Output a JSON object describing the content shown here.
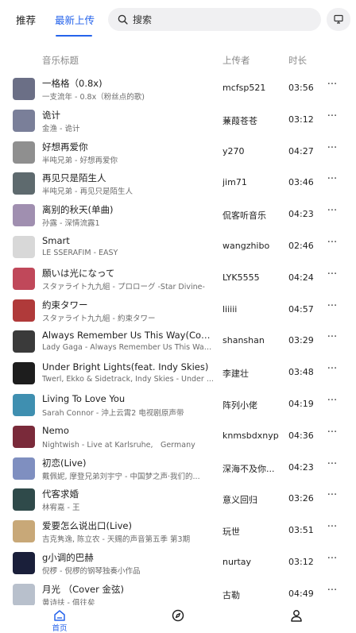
{
  "header": {
    "tabs": [
      {
        "label": "推荐",
        "active": false
      },
      {
        "label": "最新上传",
        "active": true
      }
    ],
    "search": {
      "placeholder": "搜索",
      "icon": "search-icon"
    },
    "monitor_icon": "monitor-icon",
    "accent_color": "#2563eb"
  },
  "columns": {
    "title": "音乐标题",
    "uploader": "上传者",
    "duration": "时长"
  },
  "songs": [
    {
      "title": "一格格（0.8x)",
      "sub": "一支流年 - 0.8x（粉丝点的歌)",
      "uploader": "mcfsp521",
      "duration": "03:56",
      "cover": "#6b6f86"
    },
    {
      "title": "诡计",
      "sub": "金渔 - 诡计",
      "uploader": "蒹葭苍苍",
      "duration": "03:12",
      "cover": "#7a7f99"
    },
    {
      "title": "好想再爱你",
      "sub": "半吨兄弟 - 好想再爱你",
      "uploader": "y270",
      "duration": "04:27",
      "cover": "#8f8f8f"
    },
    {
      "title": "再见只是陌生人",
      "sub": "半吨兄弟 - 再见只是陌生人",
      "uploader": "jim71",
      "duration": "03:46",
      "cover": "#5e6a6e"
    },
    {
      "title": "离别的秋天(单曲)",
      "sub": "孙露 - 深情流露1",
      "uploader": "侃客听音乐",
      "duration": "04:23",
      "cover": "#a08fb0"
    },
    {
      "title": "Smart",
      "sub": "LE SSERAFIM - EASY",
      "uploader": "wangzhibo",
      "duration": "02:46",
      "cover": "#d8d8d8"
    },
    {
      "title": "願いは光になって",
      "sub": "スタァライト九九組 - プロローグ -Star Divine-",
      "uploader": "LYK5555",
      "duration": "04:24",
      "cover": "#c0485a"
    },
    {
      "title": "約束タワー",
      "sub": "スタァライト九九組 - 約束タワー",
      "uploader": "liiiii",
      "duration": "04:57",
      "cover": "#b03a3a"
    },
    {
      "title": "Always Remember Us This Way(Compl...",
      "sub": "Lady Gaga - Always Remember Us This Way (...",
      "uploader": "shanshan",
      "duration": "03:29",
      "cover": "#3a3a3a"
    },
    {
      "title": "Under Bright Lights(feat. Indy Skies)",
      "sub": "Twerl, Ekko & Sidetrack, Indy Skies - Under ...",
      "uploader": "李建壮",
      "duration": "03:48",
      "cover": "#1d1d1d"
    },
    {
      "title": "Living To Love You",
      "sub": "Sarah Connor - 沖上云霄2 电视剧原声带",
      "uploader": "阵列小佬",
      "duration": "04:19",
      "cover": "#3f8fb0"
    },
    {
      "title": "Nemo",
      "sub": "Nightwish - Live at Karlsruhe,　Germany",
      "uploader": "knmsbdxnyp",
      "duration": "04:36",
      "cover": "#7a2a3a"
    },
    {
      "title": "初恋(Live)",
      "sub": "戴佩妮, 摩登兄弟刘宇宁 - 中国梦之声·我们的...",
      "uploader": "深海不及你...",
      "duration": "04:23",
      "cover": "#7f8fc0"
    },
    {
      "title": "代客求婚",
      "sub": "林宥嘉 - 王",
      "uploader": "意义回归",
      "duration": "03:26",
      "cover": "#2f4a4a"
    },
    {
      "title": "爱要怎么说出口(Live)",
      "sub": "吉克隽逸, 陈立农 - 天赐的声音第五季 第3期",
      "uploader": "玩世",
      "duration": "03:51",
      "cover": "#c8a878"
    },
    {
      "title": "g小调的巴赫",
      "sub": "倪椤 - 倪椤的钢琴独奏小作品",
      "uploader": "nurtay",
      "duration": "03:12",
      "cover": "#1a1f3a"
    },
    {
      "title": "月光 （Cover 金弦)",
      "sub": "黄诗扶 - 俱往矣",
      "uploader": "古勒",
      "duration": "04:49",
      "cover": "#b8c0cc"
    }
  ],
  "more_label": "···",
  "bottom_nav": {
    "home_label": "首页",
    "home_icon": "home-icon",
    "discover_icon": "compass-icon",
    "profile_icon": "user-icon"
  }
}
